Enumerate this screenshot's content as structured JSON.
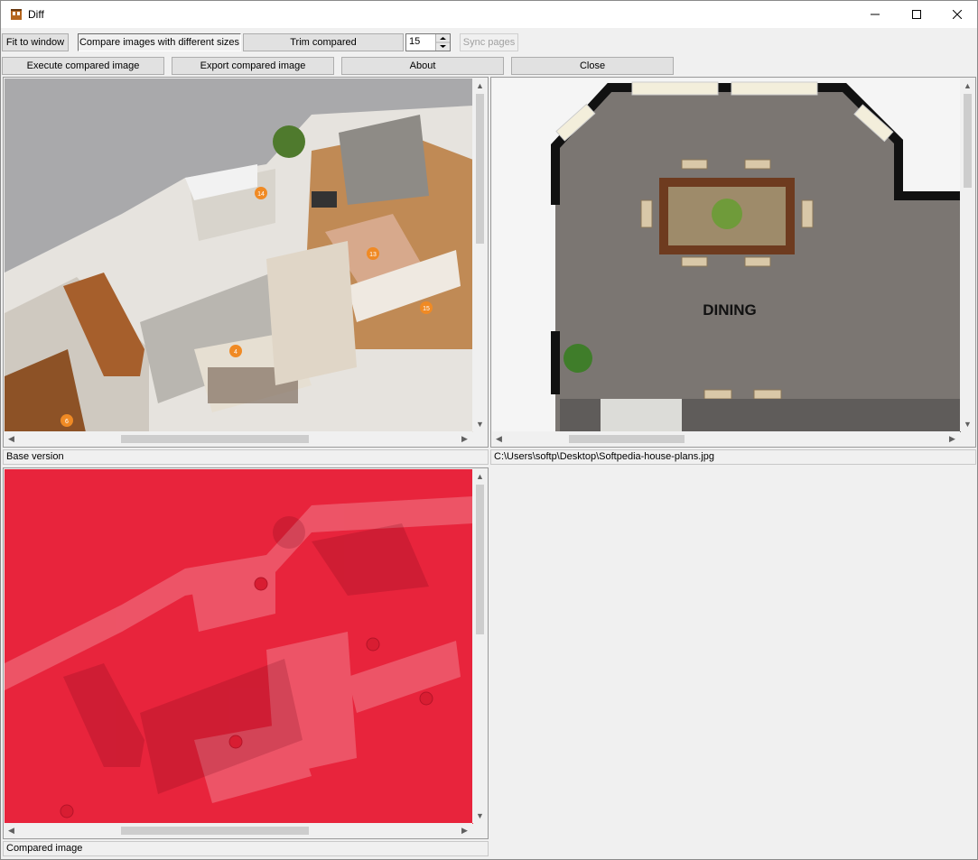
{
  "window": {
    "title": "Diff"
  },
  "toolbar": {
    "fit_to_window": "Fit to window",
    "compare_sizes": "Compare images with different sizes",
    "trim_compared": "Trim compared",
    "spin_value": "15",
    "sync_pages": "Sync pages",
    "execute": "Execute compared image",
    "export": "Export compared image",
    "about": "About",
    "close": "Close"
  },
  "panes": {
    "base_label": "Base version",
    "file_path": "C:\\Users\\softp\\Desktop\\Softpedia-house-plans.jpg",
    "compared_label": "Compared image",
    "dining_label": "DINING",
    "markers": [
      "14",
      "13",
      "15",
      "4",
      "6"
    ]
  },
  "colors": {
    "overlay": "#e8243c",
    "accent_marker": "#f08a24"
  }
}
